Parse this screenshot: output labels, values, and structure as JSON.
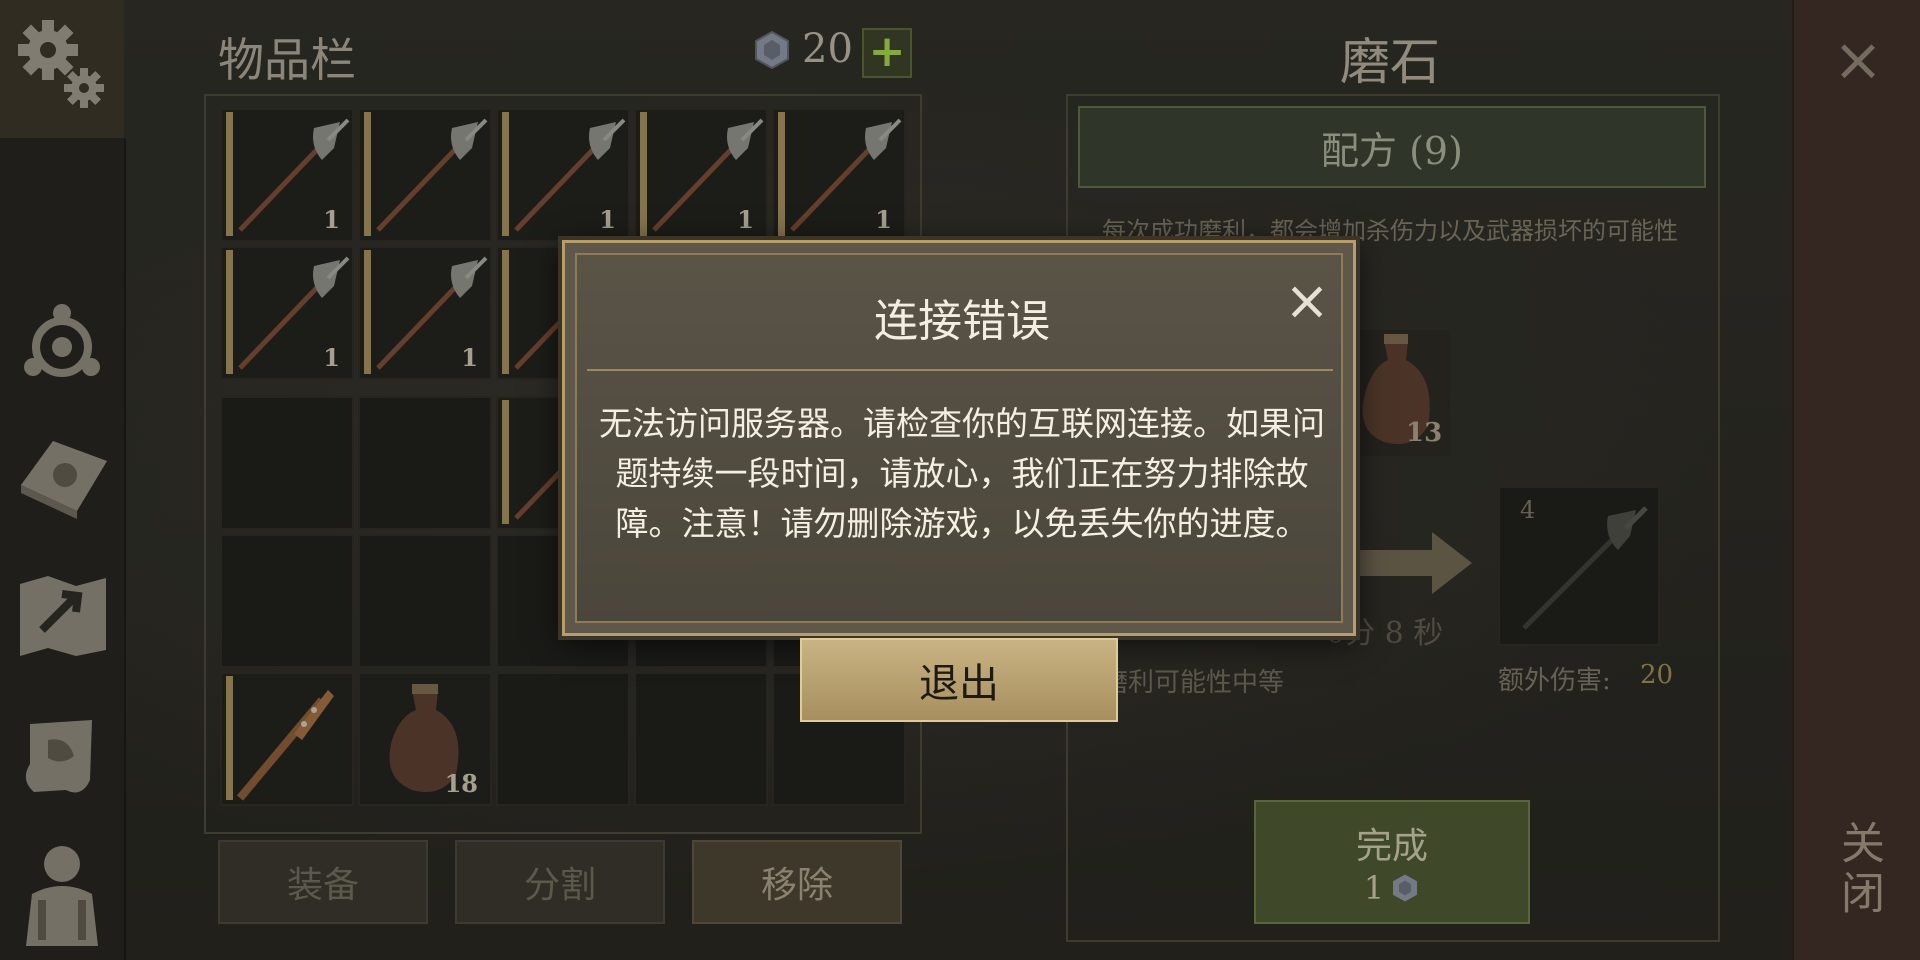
{
  "inventory": {
    "title": "物品栏",
    "currency_count": "20",
    "add_label": "+",
    "slots": [
      {
        "row": 0,
        "col": 0,
        "item": "halberd",
        "count": "1"
      },
      {
        "row": 0,
        "col": 1,
        "item": "halberd",
        "count": ""
      },
      {
        "row": 0,
        "col": 2,
        "item": "halberd",
        "count": "1"
      },
      {
        "row": 0,
        "col": 3,
        "item": "halberd",
        "count": "1"
      },
      {
        "row": 0,
        "col": 4,
        "item": "halberd",
        "count": "1"
      },
      {
        "row": 1,
        "col": 0,
        "item": "halberd",
        "count": "1"
      },
      {
        "row": 1,
        "col": 1,
        "item": "halberd",
        "count": "1"
      },
      {
        "row": 1,
        "col": 2,
        "item": "halberd",
        "count": ""
      },
      {
        "row": 2,
        "col": 2,
        "item": "halberd",
        "count": ""
      },
      {
        "row": 4,
        "col": 0,
        "item": "spiked-club",
        "count": ""
      },
      {
        "row": 4,
        "col": 1,
        "item": "leather-flask",
        "count": "18"
      }
    ],
    "buttons": {
      "equip": "装备",
      "split": "分割",
      "remove": "移除"
    }
  },
  "crafting": {
    "title": "磨石",
    "recipe_label": "配方 (9)",
    "description": "每次成功磨利，都会增加杀伤力以及武器损坏的可能性",
    "ingredient_count": "13",
    "time_text": "0分 8 秒",
    "result_badge": "4",
    "ingredient_sub_label": "磨利可能性中等",
    "extra_damage_label": "额外伤害:",
    "extra_damage_value": "20",
    "complete_label": "完成",
    "complete_cost": "1"
  },
  "right_strip": {
    "close_label": "关闭",
    "close_x": "×"
  },
  "dialog": {
    "title": "连接错误",
    "message": "无法访问服务器。请检查你的互联网连接。如果问题持续一段时间，请放心，我们正在努力排除故障。注意！请勿删除游戏，以免丢失你的进度。",
    "close": "×",
    "exit_label": "退出"
  },
  "colors": {
    "accent_gold": "#b79d6a",
    "confirm_green": "#4b5630",
    "add_green": "#9fcc4a"
  }
}
